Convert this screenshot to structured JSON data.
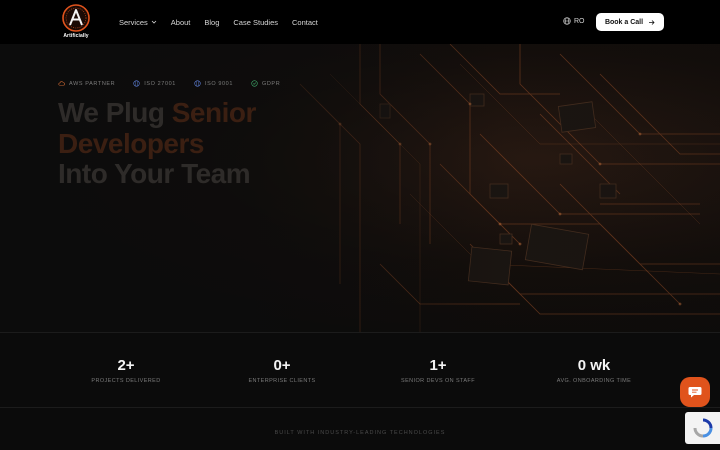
{
  "brand": {
    "name": "Artificially",
    "accent": "#e0531c"
  },
  "nav": {
    "items": [
      {
        "label": "Services",
        "has_dropdown": true
      },
      {
        "label": "About"
      },
      {
        "label": "Blog"
      },
      {
        "label": "Case Studies"
      },
      {
        "label": "Contact"
      }
    ],
    "language": "RO",
    "cta": "Book a Call"
  },
  "hero": {
    "badges": [
      "AWS PARTNER",
      "ISO 27001",
      "ISO 9001",
      "GDPR"
    ],
    "headline": {
      "line1_a": "We Plug ",
      "line1_b": "Senior",
      "line2": "Developers",
      "line3": "Into Your Team"
    }
  },
  "stats": [
    {
      "value": "2+",
      "label": "PROJECTS DELIVERED"
    },
    {
      "value": "0+",
      "label": "ENTERPRISE CLIENTS"
    },
    {
      "value": "1+",
      "label": "SENIOR DEVS ON STAFF"
    },
    {
      "value": "0 wk",
      "label": "AVG. ONBOARDING TIME"
    }
  ],
  "tech_caption": "BUILT WITH INDUSTRY-LEADING TECHNOLOGIES"
}
